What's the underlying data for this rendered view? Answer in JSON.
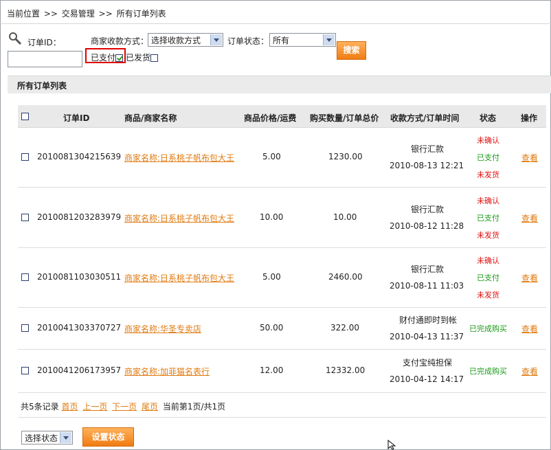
{
  "breadcrumb": {
    "items": [
      "当前位置",
      "交易管理",
      "所有订单列表"
    ],
    "separator": ">>"
  },
  "search": {
    "order_id_label": "订单ID：",
    "order_id_value": "",
    "payment_method_label": "商家收款方式：",
    "payment_method_selected": "选择收款方式",
    "order_status_label": "订单状态：",
    "order_status_selected": "所有",
    "search_button": "搜索",
    "paid_label": "已支付",
    "paid_checked": true,
    "shipped_label": "已发货",
    "shipped_checked": false
  },
  "section_title": "所有订单列表",
  "table": {
    "headers": {
      "order_id": "订单ID",
      "product": "商品/商家名称",
      "price": "商品价格/运费",
      "quantity": "购买数量/订单总价",
      "payment": "收款方式/订单时间",
      "status": "状态",
      "action": "操作"
    },
    "rows": [
      {
        "id": "2010081304215639",
        "merchant": "商家名称:日系桃子帆布包大王",
        "price": "5.00",
        "total": "1230.00",
        "method": "银行汇款",
        "time": "2010-08-13 12:21",
        "status": [
          "未确认",
          "已支付",
          "未发货"
        ],
        "action": "查看"
      },
      {
        "id": "2010081203283979",
        "merchant": "商家名称:日系桃子帆布包大王",
        "price": "10.00",
        "total": "10.00",
        "method": "银行汇款",
        "time": "2010-08-12 11:28",
        "status": [
          "未确认",
          "已支付",
          "未发货"
        ],
        "action": "查看"
      },
      {
        "id": "2010081103030511",
        "merchant": "商家名称:日系桃子帆布包大王",
        "price": "5.00",
        "total": "2460.00",
        "method": "银行汇款",
        "time": "2010-08-11 11:03",
        "status": [
          "未确认",
          "已支付",
          "未发货"
        ],
        "action": "查看"
      },
      {
        "id": "2010041303370727",
        "merchant": "商家名称:华圣专卖店",
        "price": "50.00",
        "total": "322.00",
        "method": "财付通即时到帐",
        "time": "2010-04-13 11:37",
        "status": [
          "已完成购买"
        ],
        "action": "查看"
      },
      {
        "id": "2010041206173957",
        "merchant": "商家名称:加菲猫名表行",
        "price": "12.00",
        "total": "12332.00",
        "method": "支付宝纯担保",
        "time": "2010-04-12 14:17",
        "status": [
          "已完成购买"
        ],
        "action": "查看"
      }
    ]
  },
  "pager": {
    "summary": "共5条记录",
    "first": "首页",
    "prev": "上一页",
    "next": "下一页",
    "last": "尾页",
    "current": "当前第1页/共1页"
  },
  "bulk": {
    "status_select": "选择状态",
    "set_button": "设置状态"
  },
  "colors": {
    "accent": "#f07c12",
    "link": "#e07a10",
    "status_red": "#e01010",
    "status_green": "#1a9a1a",
    "highlight": "#e00000"
  }
}
